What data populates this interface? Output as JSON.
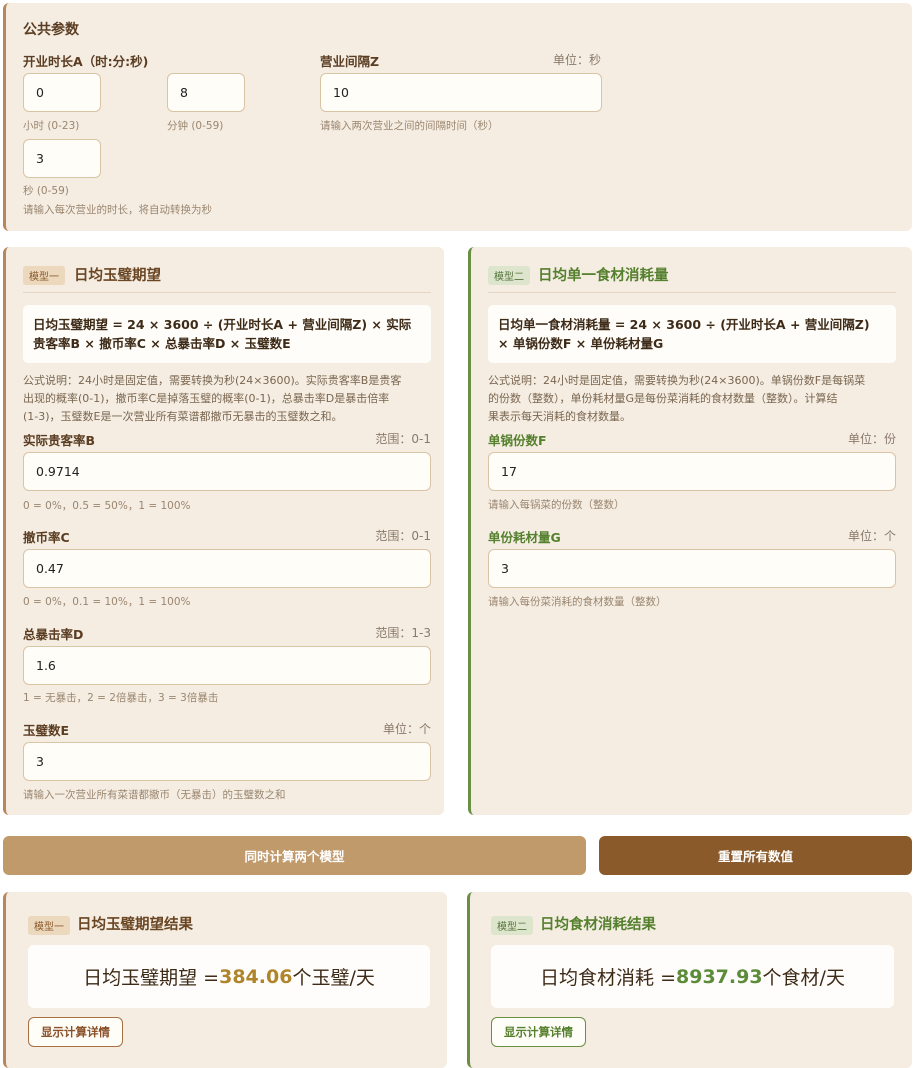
{
  "common": {
    "title": "公共参数",
    "duration_label": "开业时长A（时:分:秒)",
    "hours_value": "0",
    "hours_hint": "小时 (0-23)",
    "minutes_value": "8",
    "minutes_hint": "分钟 (0-59)",
    "seconds_value": "3",
    "seconds_hint": "秒 (0-59)",
    "duration_hint": "请输入每次营业的时长，将自动转换为秒",
    "interval_label": "营业间隔Z",
    "interval_unit": "单位：秒",
    "interval_value": "10",
    "interval_hint": "请输入两次营业之间的间隔时间（秒）"
  },
  "model1": {
    "badge": "模型一",
    "title": "日均玉璧期望",
    "formula_line1": "日均玉璧期望 = 24 × 3600 ÷ (开业时长A + 营业间隔Z) × 实际",
    "formula_line2": "贵客率B × 撤币率C × 总暴击率D × 玉璧数E",
    "desc_line1": "公式说明：24小时是固定值，需要转换为秒(24×3600)。实际贵客率B是贵客",
    "desc_line2": "出现的概率(0-1)，撤币率C是掉落玉璧的概率(0-1)，总暴击率D是暴击倍率",
    "desc_line3": "(1-3)，玉璧数E是一次营业所有菜谱都撤币无暴击的玉璧数之和。",
    "fields": [
      {
        "label": "实际贵客率B",
        "unit": "范围：0-1",
        "value": "0.9714",
        "hint": "0 = 0%，0.5 = 50%，1 = 100%"
      },
      {
        "label": "撤币率C",
        "unit": "范围：0-1",
        "value": "0.47",
        "hint": "0 = 0%，0.1 = 10%，1 = 100%"
      },
      {
        "label": "总暴击率D",
        "unit": "范围：1-3",
        "value": "1.6",
        "hint": "1 = 无暴击，2 = 2倍暴击，3 = 3倍暴击"
      },
      {
        "label": "玉璧数E",
        "unit": "单位：个",
        "value": "3",
        "hint": "请输入一次营业所有菜谱都撤币（无暴击）的玉璧数之和"
      }
    ]
  },
  "model2": {
    "badge": "模型二",
    "title": "日均单一食材消耗量",
    "formula_line1": "日均单一食材消耗量 = 24 × 3600 ÷ (开业时长A + 营业间隔Z)",
    "formula_line2": "× 单锅份数F × 单份耗材量G",
    "desc_line1": "公式说明：24小时是固定值，需要转换为秒(24×3600)。单锅份数F是每锅菜",
    "desc_line2": "的份数（整数），单份耗材量G是每份菜消耗的食材数量（整数）。计算结",
    "desc_line3": "果表示每天消耗的食材数量。",
    "fields": [
      {
        "label": "单锅份数F",
        "unit": "单位：份",
        "value": "17",
        "hint": "请输入每锅菜的份数（整数）"
      },
      {
        "label": "单份耗材量G",
        "unit": "单位：个",
        "value": "3",
        "hint": "请输入每份菜消耗的食材数量（整数）"
      }
    ]
  },
  "buttons": {
    "calculate": "同时计算两个模型",
    "reset": "重置所有数值"
  },
  "result1": {
    "badge": "模型一",
    "title": "日均玉璧期望结果",
    "prefix": "日均玉璧期望 =",
    "value": "384.06",
    "suffix": "个玉璧/天",
    "details_button": "显示计算详情"
  },
  "result2": {
    "badge": "模型二",
    "title": "日均食材消耗结果",
    "prefix": "日均食材消耗 =",
    "value": "8937.93",
    "suffix": "个食材/天",
    "details_button": "显示计算详情"
  }
}
